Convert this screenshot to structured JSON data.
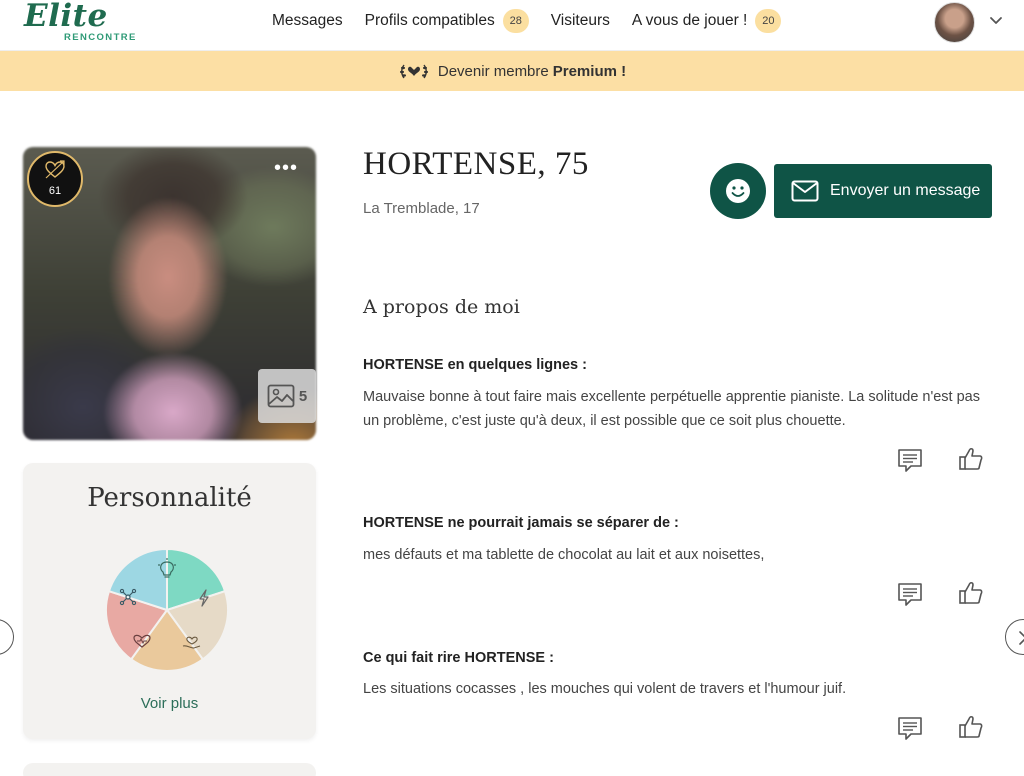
{
  "header": {
    "logo_text": "Elite",
    "logo_subtext": "RENCONTRE",
    "nav": [
      {
        "label": "Messages"
      },
      {
        "label": "Profils compatibles",
        "badge": "28"
      },
      {
        "label": "Visiteurs"
      },
      {
        "label": "A vous de jouer !",
        "badge": "20"
      }
    ]
  },
  "banner": {
    "text": "Devenir membre",
    "strong": "Premium !"
  },
  "photo": {
    "compatibility_score": "61",
    "more_label": "•••",
    "photo_count": "5"
  },
  "personality": {
    "title": "Personnalité",
    "more_label": "Voir plus",
    "segments": [
      {
        "icon": "lightbulb-icon",
        "color": "#7ed9c3"
      },
      {
        "icon": "lightning-icon",
        "color": "#e6dac7"
      },
      {
        "icon": "hand-heart-icon",
        "color": "#eac99c"
      },
      {
        "icon": "heart-icon",
        "color": "#e8a9a3"
      },
      {
        "icon": "network-icon",
        "color": "#9dd7e3"
      }
    ]
  },
  "profile": {
    "name": "HORTENSE, 75",
    "location": "La Tremblade, 17",
    "message_button": "Envoyer un message"
  },
  "about": {
    "title": "A propos de moi",
    "items": [
      {
        "question": "HORTENSE en quelques lignes :",
        "answer": "Mauvaise bonne à tout faire mais excellente perpétuelle apprentie pianiste. La solitude n'est pas un problème, c'est juste qu'à deux, il est possible que ce soit plus chouette."
      },
      {
        "question": "HORTENSE ne pourrait jamais se séparer de :",
        "answer": "mes défauts et ma tablette de chocolat au lait et aux noisettes,"
      },
      {
        "question": "Ce qui fait rire HORTENSE :",
        "answer": "Les situations cocasses , les mouches qui volent de travers et l'humour juif."
      }
    ]
  }
}
